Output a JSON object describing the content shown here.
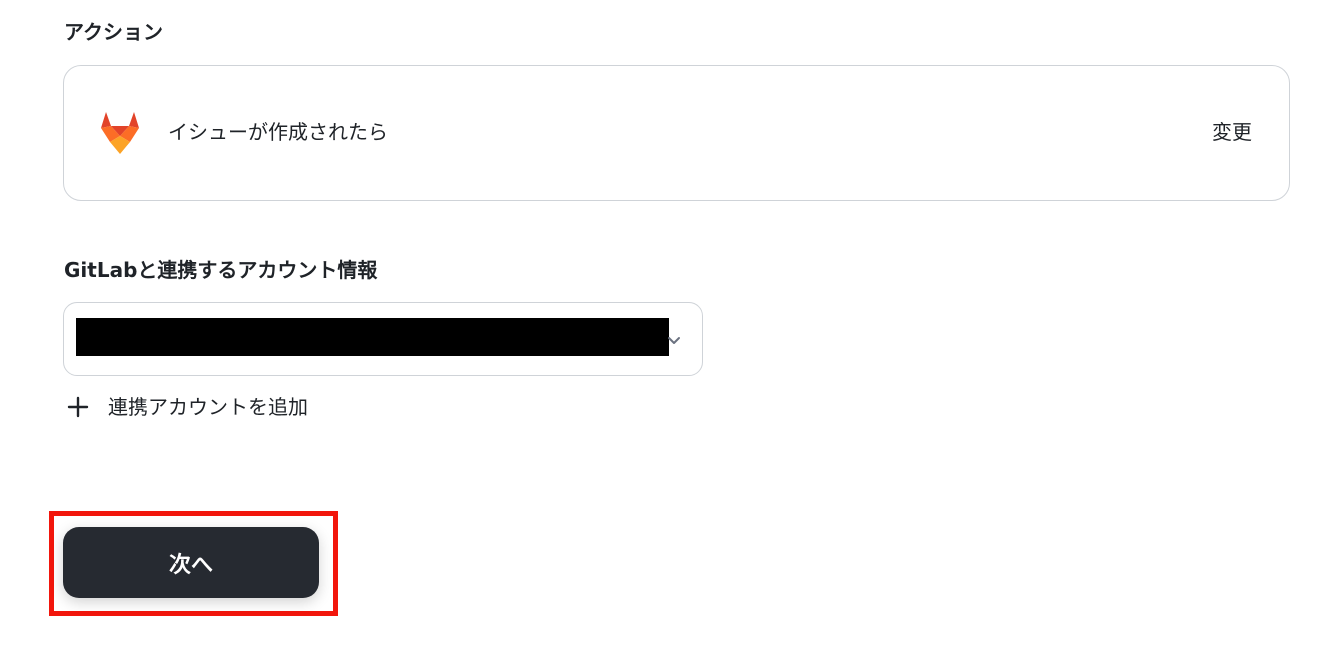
{
  "sections": {
    "action_label": "アクション",
    "account_label": "GitLabと連携するアカウント情報"
  },
  "action_card": {
    "app_icon": "gitlab-icon",
    "trigger_text": "イシューが作成されたら",
    "change_label": "変更"
  },
  "account_select": {
    "value_redacted": true,
    "chevron_icon": "chevron-down-icon"
  },
  "add_account": {
    "icon": "plus-icon",
    "label": "連携アカウントを追加"
  },
  "next_button": {
    "label": "次へ"
  },
  "colors": {
    "button_bg": "#262a31",
    "highlight": "#f2160c",
    "gitlab_orange": "#e24329"
  }
}
